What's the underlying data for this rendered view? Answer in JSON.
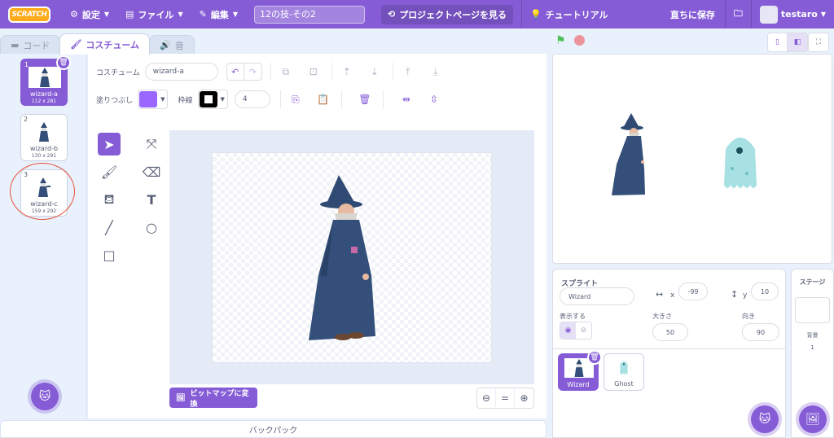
{
  "menu": {
    "logo": "SCRATCH",
    "settings": "設定",
    "file": "ファイル",
    "edit": "編集",
    "project_title": "12の技-その2",
    "project_page": "プロジェクトページを見る",
    "tutorials": "チュートリアル",
    "save_now": "直ちに保存",
    "username": "testaro"
  },
  "tabs": [
    {
      "label": "コード"
    },
    {
      "label": "コスチューム"
    },
    {
      "label": "音"
    }
  ],
  "costumes": [
    {
      "num": "1",
      "name": "wizard-a",
      "size": "112 x 281"
    },
    {
      "num": "2",
      "name": "wizard-b",
      "size": "130 x 291"
    },
    {
      "num": "3",
      "name": "wizard-c",
      "size": "159 x 292"
    }
  ],
  "paint": {
    "costume_label": "コスチューム",
    "costume_name": "wizard-a",
    "fill_label": "塗りつぶし",
    "outline_label": "枠線",
    "outline_width": "4",
    "fill_color": "#9966ff",
    "outline_color": "#000000",
    "convert_bitmap": "ビットマップに変換"
  },
  "backpack": "バックパック",
  "sprite": {
    "label": "スプライト",
    "name": "Wizard",
    "x_label": "x",
    "x_value": "-99",
    "y_label": "y",
    "y_value": "10",
    "show_label": "表示する",
    "size_label": "大きさ",
    "size_value": "50",
    "direction_label": "向き",
    "direction_value": "90"
  },
  "sprites": [
    {
      "name": "Wizard"
    },
    {
      "name": "Ghost"
    }
  ],
  "stage_pane": {
    "label": "ステージ",
    "backdrops_label": "背景",
    "backdrops_count": "1"
  },
  "colors": {
    "accent": "#855cd6",
    "flag": "#4cbf56",
    "stop": "#ec5959",
    "annotation": "#e5533b"
  }
}
